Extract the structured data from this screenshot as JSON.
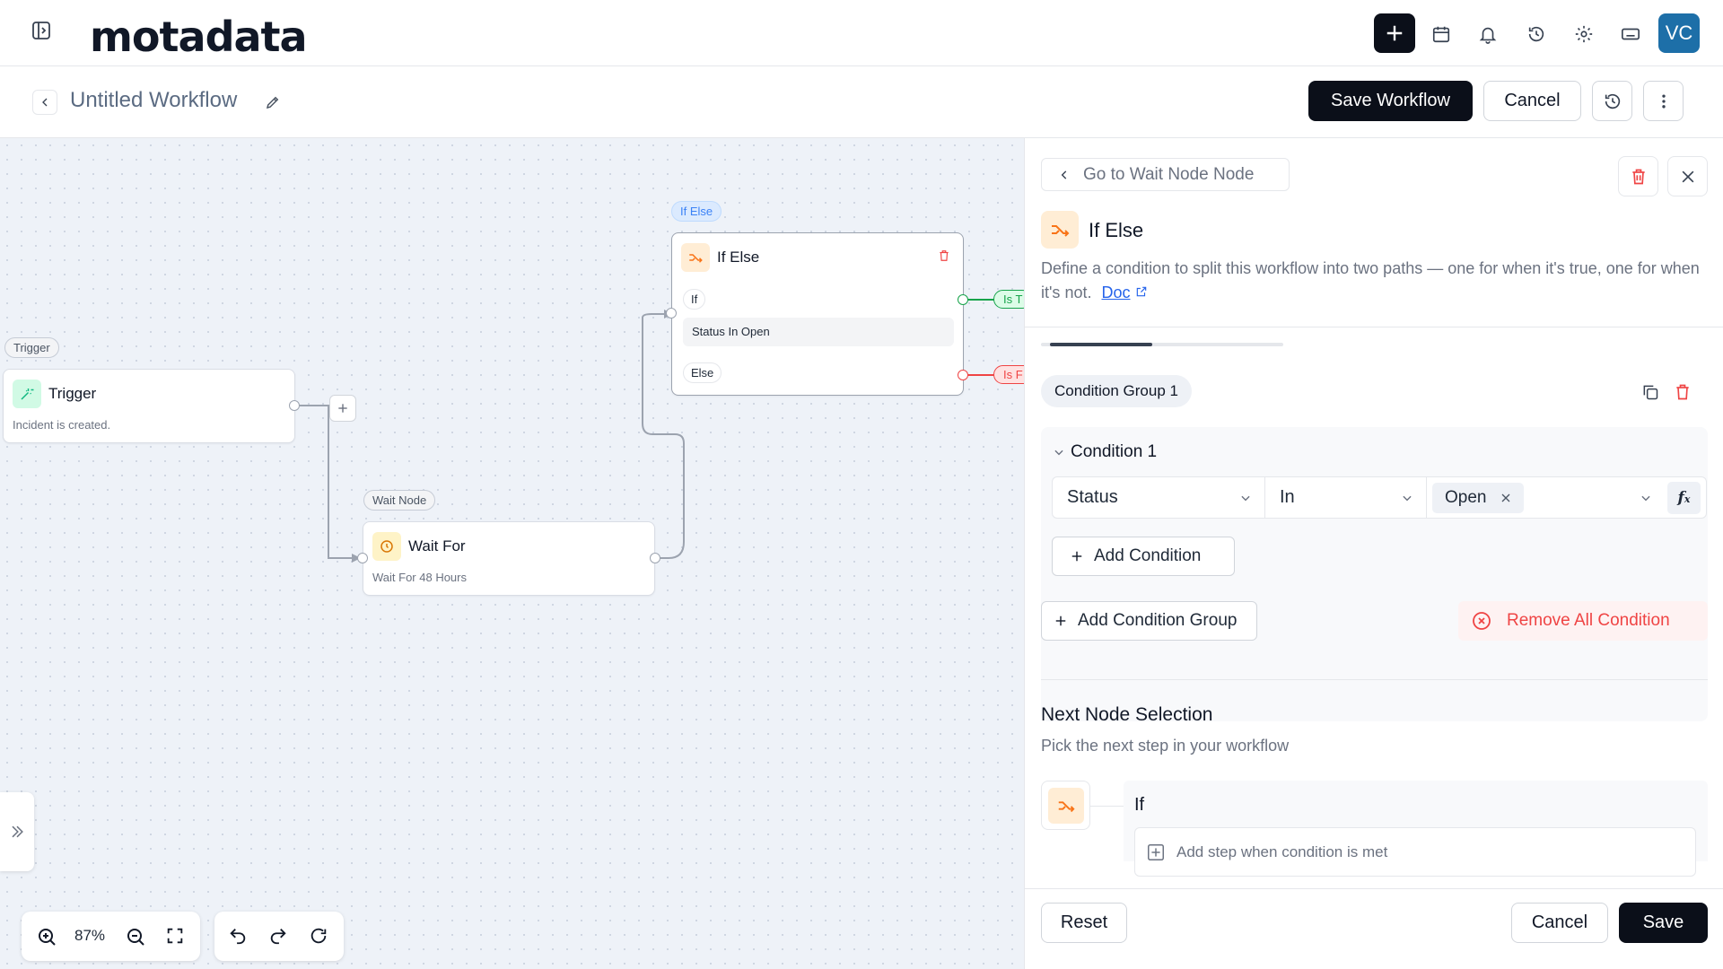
{
  "app": {
    "logo_text": "motadata",
    "avatar_initials": "VC"
  },
  "header": {
    "title": "Untitled Workflow",
    "save_label": "Save Workflow",
    "cancel_label": "Cancel"
  },
  "canvas": {
    "trigger": {
      "tag": "Trigger",
      "title": "Trigger",
      "desc": "Incident is created."
    },
    "wait": {
      "tag": "Wait Node",
      "title": "Wait For",
      "desc": "Wait For 48 Hours"
    },
    "ifelse": {
      "tag": "If Else",
      "title": "If Else",
      "if_label": "If",
      "condition": "Status In Open",
      "else_label": "Else",
      "true_label": "Is T",
      "false_label": "Is F"
    },
    "zoom": "87%"
  },
  "panel": {
    "back_label": "Go to Wait Node Node",
    "title": "If Else",
    "description": "Define a condition to split this workflow into two paths — one for when it's true, one for when it's not.",
    "doc_link": "Doc",
    "group_label": "Condition Group 1",
    "condition_label": "Condition 1",
    "field_value": "Status",
    "operator_value": "In",
    "chip_value": "Open",
    "add_condition": "Add Condition",
    "add_group": "Add Condition Group",
    "remove_all": "Remove All Condition",
    "next_title": "Next Node Selection",
    "next_sub": "Pick the next step in your workflow",
    "if_branch": "If",
    "add_step": "Add step when condition is met",
    "reset": "Reset",
    "cancel": "Cancel",
    "save": "Save"
  },
  "colors": {
    "primary_dark": "#0b0f19",
    "accent_orange": "#f97316",
    "danger": "#ef4444",
    "success": "#16a34a",
    "link": "#2563eb"
  }
}
